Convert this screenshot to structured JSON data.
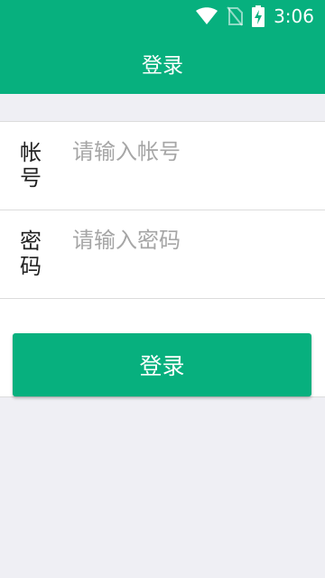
{
  "status_bar": {
    "time": "3:06",
    "icons": [
      "wifi-icon",
      "no-sim-icon",
      "battery-charging-icon"
    ]
  },
  "header": {
    "title": "登录"
  },
  "form": {
    "account": {
      "label": "帐号",
      "placeholder": "请输入帐号",
      "value": ""
    },
    "password": {
      "label": "密码",
      "placeholder": "请输入密码",
      "value": ""
    }
  },
  "actions": {
    "login_label": "登录"
  },
  "colors": {
    "primary": "#07b07e",
    "background": "#efeff4",
    "placeholder": "#a6a6a6"
  }
}
